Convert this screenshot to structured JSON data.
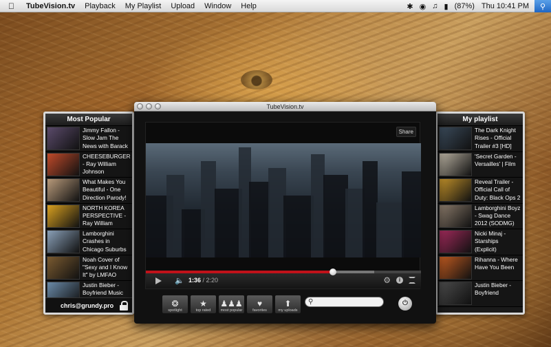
{
  "menubar": {
    "apple_icon": "apple-icon",
    "app_name": "TubeVision.tv",
    "items": [
      "Playback",
      "My Playlist",
      "Upload",
      "Window",
      "Help"
    ],
    "battery": "(87%)",
    "clock": "Thu 10:41 PM"
  },
  "window": {
    "title": "TubeVision.tv",
    "share_label": "Share",
    "time_current": "1:36",
    "time_total": " / 2:20",
    "progress_played": 0.68,
    "progress_buffered": 0.83
  },
  "most_popular": {
    "title": "Most Popular",
    "items": [
      {
        "title": "Jimmy Fallon - Slow Jam The News with Barack Obama:",
        "color": "#5a4a6a"
      },
      {
        "title": "CHEESEBURGER! - Ray William Johnson",
        "color": "#c04a2a"
      },
      {
        "title": "What Makes You Beautiful - One Direction Parody!",
        "color": "#b89a7a"
      },
      {
        "title": "NORTH KOREA PERSPECTIVE - Ray William",
        "color": "#d8a020"
      },
      {
        "title": "Lamborghini Crashes in Chicago Suburbs",
        "color": "#8aa0b8"
      },
      {
        "title": "Noah Cover of \"Sexy and I Know It\" by LMFAO",
        "color": "#7a5a30"
      },
      {
        "title": "Justin Bieber - Boyfriend Music",
        "color": "#6a8aa8"
      }
    ],
    "footer_email": "chris@grundy.pro"
  },
  "my_playlist": {
    "title": "My playlist",
    "items": [
      {
        "title": "The Dark Knight Rises - Official Trailer #3 [HD]",
        "color": "#3a4a5a"
      },
      {
        "title": "'Secret Garden - Versailles' | Film",
        "color": "#b8b0a0"
      },
      {
        "title": "Reveal Trailer - Official Call of Duty: Black Ops 2",
        "color": "#c0902a"
      },
      {
        "title": "Lamborghini Boyz - Swag Dance 2012 (SODMG)",
        "color": "#8a7a6a"
      },
      {
        "title": "Nicki Minaj - Starships (Explicit)",
        "color": "#a02a5a"
      },
      {
        "title": "Rihanna - Where Have You Been",
        "color": "#c05a20"
      },
      {
        "title": "Justin Bieber - Boyfriend",
        "color": "#4a4a4a"
      }
    ]
  },
  "toolbar": {
    "buttons": [
      {
        "name": "spotlight",
        "label": "spotlight",
        "glyph": "❂"
      },
      {
        "name": "top-rated",
        "label": "top rated",
        "glyph": "★"
      },
      {
        "name": "most-popular",
        "label": "most popular",
        "glyph": "♟♟♟"
      },
      {
        "name": "favorites",
        "label": "favorites",
        "glyph": "♥"
      },
      {
        "name": "my-uploads",
        "label": "my uploads",
        "glyph": "⬆"
      }
    ],
    "search_placeholder": "",
    "power_glyph": "⏻"
  }
}
